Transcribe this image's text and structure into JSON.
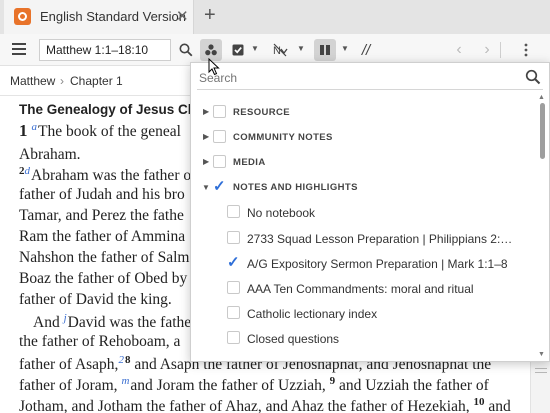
{
  "tab": {
    "title": "English Standard Version",
    "close": "✕",
    "new_tab": "+"
  },
  "toolbar": {
    "reference_value": "Matthew 1:1–18:10",
    "parallel_mark": "//"
  },
  "breadcrumb": {
    "book": "Matthew",
    "separator": "›",
    "chapter": "Chapter 1"
  },
  "bible": {
    "heading": "The Genealogy of Jesus Chri",
    "lines": [
      {
        "ch": "1",
        "fn": "a",
        "text": "The book of the geneal"
      },
      {
        "text": "Abraham."
      },
      {
        "vn": "2",
        "fn": "d",
        "text": "Abraham was the father o"
      },
      {
        "text": "father of Judah and his bro"
      },
      {
        "text": "Tamar, and Perez the fathe"
      },
      {
        "text": "Ram the father of Ammina"
      },
      {
        "text": "Nahshon the father of Salm"
      },
      {
        "text": "Boaz the father of Obed by"
      },
      {
        "text": "father of David the king."
      },
      {
        "indent": true,
        "text_a": "And ",
        "fn": "j",
        "text": "David was the fathe"
      },
      {
        "text": "the father of Rehoboam, a"
      },
      {
        "text": "father of Asaph,",
        "sup": "2",
        "vn": "8",
        "text_b": " and Asaph the father of Jehoshaphat, and Jehoshaphat the"
      },
      {
        "text": "father of Joram, ",
        "fn": "m",
        "text_b": "and Joram the father of Uzziah, ",
        "vn": "9",
        "text_c": " and Uzziah the father of"
      },
      {
        "text": "Jotham, and Jotham the father of Ahaz, and Ahaz the father of Hezekiah, ",
        "vn": "10",
        "text_c": " and"
      }
    ]
  },
  "panel": {
    "search_placeholder": "Search",
    "categories": [
      {
        "label": "RESOURCE",
        "expanded": false,
        "checked": false
      },
      {
        "label": "COMMUNITY NOTES",
        "expanded": false,
        "checked": false
      },
      {
        "label": "MEDIA",
        "expanded": false,
        "checked": false
      },
      {
        "label": "NOTES AND HIGHLIGHTS",
        "expanded": true,
        "checked": true
      }
    ],
    "items": [
      {
        "label": "No notebook",
        "checked": false
      },
      {
        "label": "2733 Squad Lesson Preparation | Philippians 2:…",
        "checked": false
      },
      {
        "label": "A/G Expository Sermon Preparation | Mark 1:1–8",
        "checked": true
      },
      {
        "label": "AAA Ten Commandments: moral and ritual",
        "checked": false
      },
      {
        "label": "Catholic lectionary index",
        "checked": false
      },
      {
        "label": "Closed questions",
        "checked": false
      }
    ]
  },
  "colors": {
    "accent": "#2f6fd8",
    "logo": "#e8732a",
    "footnote": "#3b6fd1"
  },
  "icons": [
    "app-logo-icon",
    "close-icon",
    "plus-icon",
    "hamburger-icon",
    "search-icon",
    "visual-filter-icon",
    "checkbox-icon",
    "text-format-icon",
    "layout-icon",
    "parallel-icon",
    "back-icon",
    "forward-icon",
    "more-icon"
  ]
}
